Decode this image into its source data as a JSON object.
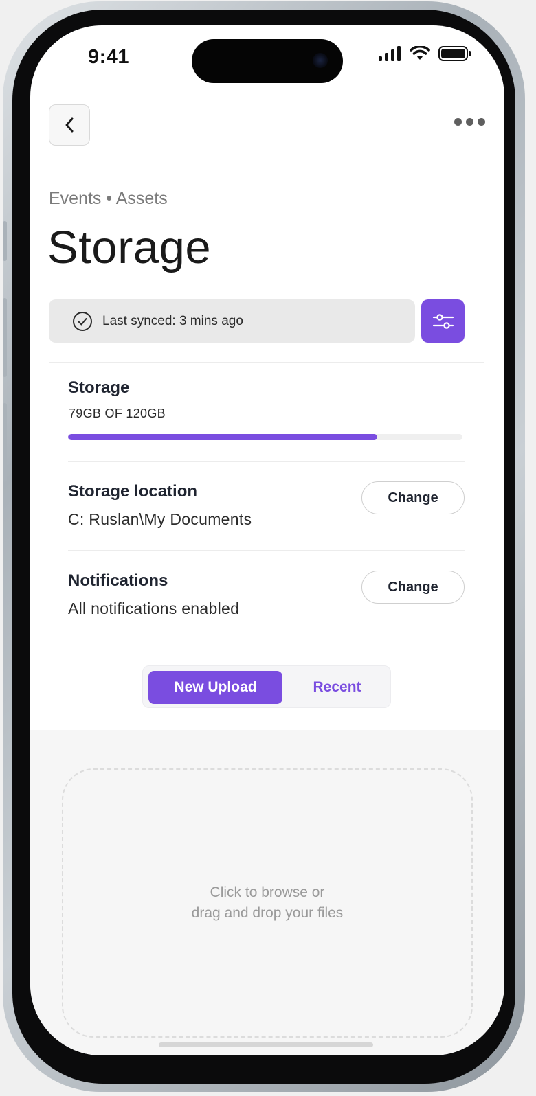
{
  "status_bar": {
    "time": "9:41"
  },
  "header": {
    "breadcrumb": "Events • Assets",
    "title": "Storage"
  },
  "sync": {
    "text": "Last synced: 3 mins ago"
  },
  "storage": {
    "label": "Storage",
    "usage_text": "79GB OF 120GB",
    "used_fraction": 0.7833
  },
  "location": {
    "label": "Storage location",
    "value": "C: Ruslan\\My Documents",
    "button": "Change"
  },
  "notifications": {
    "label": "Notifications",
    "value": "All notifications enabled",
    "button": "Change"
  },
  "tabs": {
    "active": "New Upload",
    "inactive": "Recent"
  },
  "dropzone": {
    "line1": "Click to browse or",
    "line2": "drag and drop your files"
  },
  "colors": {
    "accent": "#7a4de0"
  }
}
